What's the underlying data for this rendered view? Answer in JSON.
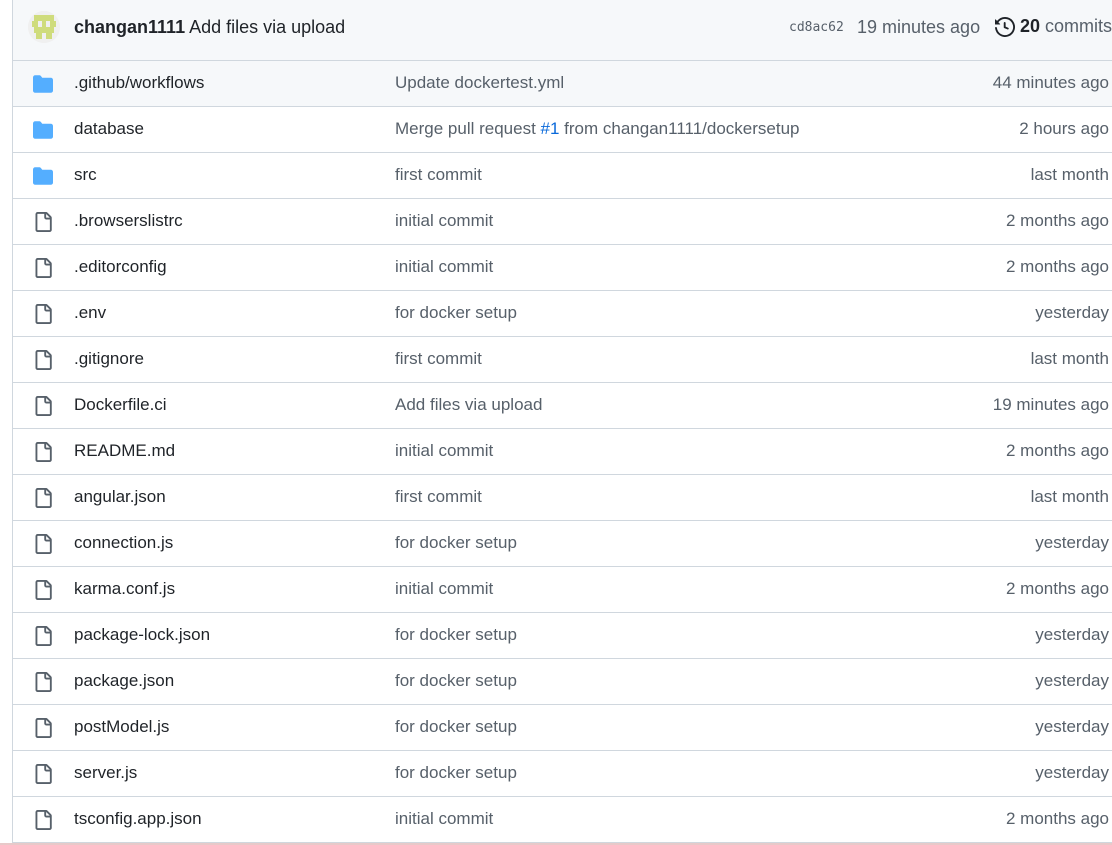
{
  "latest_commit": {
    "author": "changan1111",
    "message": "Add files via upload",
    "sha": "cd8ac62",
    "time": "19 minutes ago",
    "commit_count": "20",
    "commits_label": "commits"
  },
  "files": [
    {
      "name": ".github/workflows",
      "type": "folder",
      "commit": "Update dockertest.yml",
      "age": "44 minutes ago"
    },
    {
      "name": "database",
      "type": "folder",
      "commit_prefix": "Merge pull request ",
      "commit_link": "#1",
      "commit_suffix": " from changan1111/dockersetup",
      "age": "2 hours ago"
    },
    {
      "name": "src",
      "type": "folder",
      "commit": "first commit",
      "age": "last month"
    },
    {
      "name": ".browserslistrc",
      "type": "file",
      "commit": "initial commit",
      "age": "2 months ago"
    },
    {
      "name": ".editorconfig",
      "type": "file",
      "commit": "initial commit",
      "age": "2 months ago"
    },
    {
      "name": ".env",
      "type": "file",
      "commit": "for docker setup",
      "age": "yesterday"
    },
    {
      "name": ".gitignore",
      "type": "file",
      "commit": "first commit",
      "age": "last month"
    },
    {
      "name": "Dockerfile.ci",
      "type": "file",
      "commit": "Add files via upload",
      "age": "19 minutes ago"
    },
    {
      "name": "README.md",
      "type": "file",
      "commit": "initial commit",
      "age": "2 months ago"
    },
    {
      "name": "angular.json",
      "type": "file",
      "commit": "first commit",
      "age": "last month"
    },
    {
      "name": "connection.js",
      "type": "file",
      "commit": "for docker setup",
      "age": "yesterday"
    },
    {
      "name": "karma.conf.js",
      "type": "file",
      "commit": "initial commit",
      "age": "2 months ago"
    },
    {
      "name": "package-lock.json",
      "type": "file",
      "commit": "for docker setup",
      "age": "yesterday"
    },
    {
      "name": "package.json",
      "type": "file",
      "commit": "for docker setup",
      "age": "yesterday"
    },
    {
      "name": "postModel.js",
      "type": "file",
      "commit": "for docker setup",
      "age": "yesterday"
    },
    {
      "name": "server.js",
      "type": "file",
      "commit": "for docker setup",
      "age": "yesterday"
    },
    {
      "name": "tsconfig.app.json",
      "type": "file",
      "commit": "initial commit",
      "age": "2 months ago"
    }
  ],
  "colors": {
    "folder": "#54aeff",
    "link": "#0969da",
    "avatar": "#cfdc7c"
  }
}
